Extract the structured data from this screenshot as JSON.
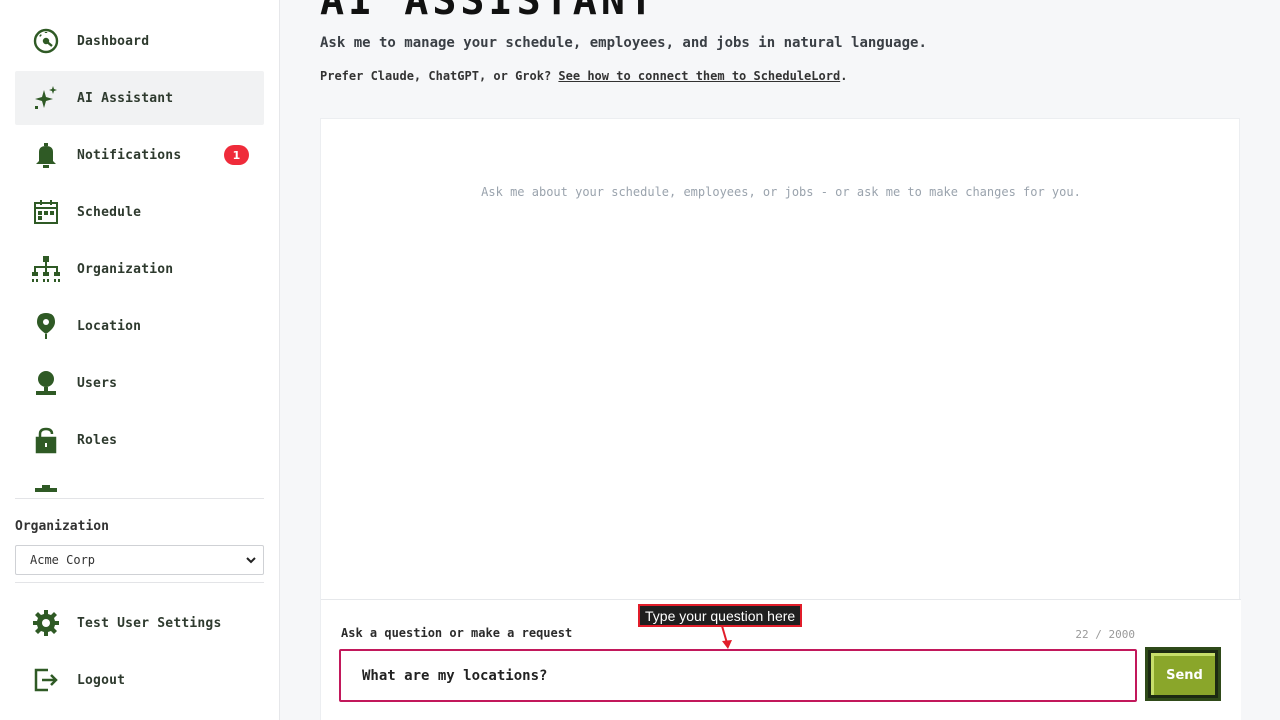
{
  "sidebar": {
    "items": [
      {
        "label": "Dashboard",
        "icon": "dashboard-gauge-icon"
      },
      {
        "label": "AI Assistant",
        "icon": "sparkle-icon",
        "active": true
      },
      {
        "label": "Notifications",
        "icon": "bell-icon",
        "badge": "1"
      },
      {
        "label": "Schedule",
        "icon": "calendar-icon"
      },
      {
        "label": "Organization",
        "icon": "org-chart-icon"
      },
      {
        "label": "Location",
        "icon": "map-pin-icon"
      },
      {
        "label": "Users",
        "icon": "user-icon"
      },
      {
        "label": "Roles",
        "icon": "lock-icon"
      }
    ],
    "organization_label": "Organization",
    "organization_selected": "Acme Corp",
    "bottom_items": [
      {
        "label": "Test User Settings",
        "icon": "gear-icon"
      },
      {
        "label": "Logout",
        "icon": "logout-icon"
      }
    ]
  },
  "main": {
    "title": "AI ASSISTANT",
    "subtitle": "Ask me to manage your schedule, employees, and jobs in natural language.",
    "connect_prefix": "Prefer Claude, ChatGPT, or Grok?",
    "connect_link": "See how to connect them to ScheduleLord",
    "connect_suffix": ".",
    "empty_hint": "Ask me about your schedule, employees, or jobs - or ask me to make changes for you.",
    "composer": {
      "label": "Ask a question or make a request",
      "char_count": "22 / 2000",
      "input_value": "What are my locations?",
      "send_label": "Send"
    },
    "tooltip": "Type your question here"
  },
  "colors": {
    "icon_green": "#2f5a25",
    "badge_red": "#ef2b3a",
    "send_green": "#8aa62a",
    "input_border": "#c2185b",
    "tooltip_border": "#e11d2a"
  }
}
